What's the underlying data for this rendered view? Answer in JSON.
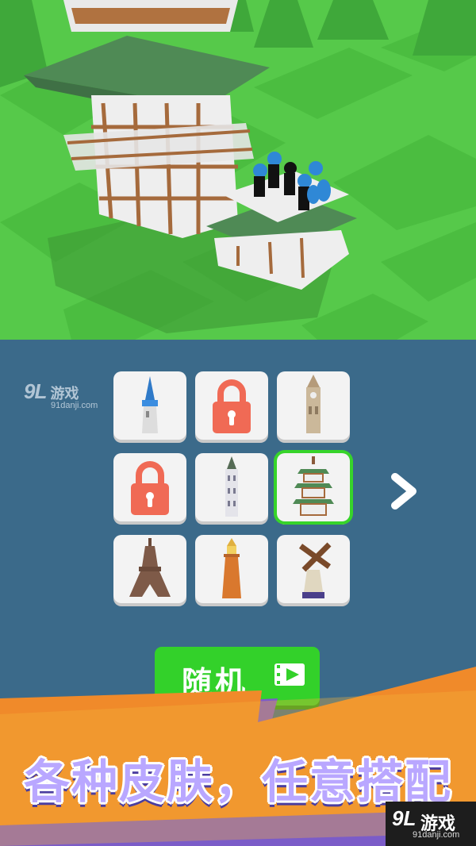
{
  "watermark": {
    "logo": "9L",
    "name": "游戏",
    "url": "91danji.com"
  },
  "skins": [
    {
      "icon": "blue-spire-tower-icon",
      "locked": false,
      "selected": false
    },
    {
      "icon": "padlock-icon",
      "locked": true,
      "selected": false
    },
    {
      "icon": "clock-tower-icon",
      "locked": false,
      "selected": false
    },
    {
      "icon": "padlock-icon",
      "locked": true,
      "selected": false
    },
    {
      "icon": "gothic-tower-icon",
      "locked": false,
      "selected": false
    },
    {
      "icon": "pagoda-tower-icon",
      "locked": false,
      "selected": true
    },
    {
      "icon": "eiffel-tower-icon",
      "locked": false,
      "selected": false
    },
    {
      "icon": "lighthouse-tower-icon",
      "locked": false,
      "selected": false
    },
    {
      "icon": "windmill-tower-icon",
      "locked": false,
      "selected": false
    }
  ],
  "random_button": {
    "label": "随机"
  },
  "promo": {
    "headline": "各种皮肤，任意搭配"
  },
  "colors": {
    "selected": "#37d42a",
    "button": "#33d12a",
    "panel": "#3b6a8a",
    "banner": "#f08a2a",
    "lock": "#f06a55"
  }
}
